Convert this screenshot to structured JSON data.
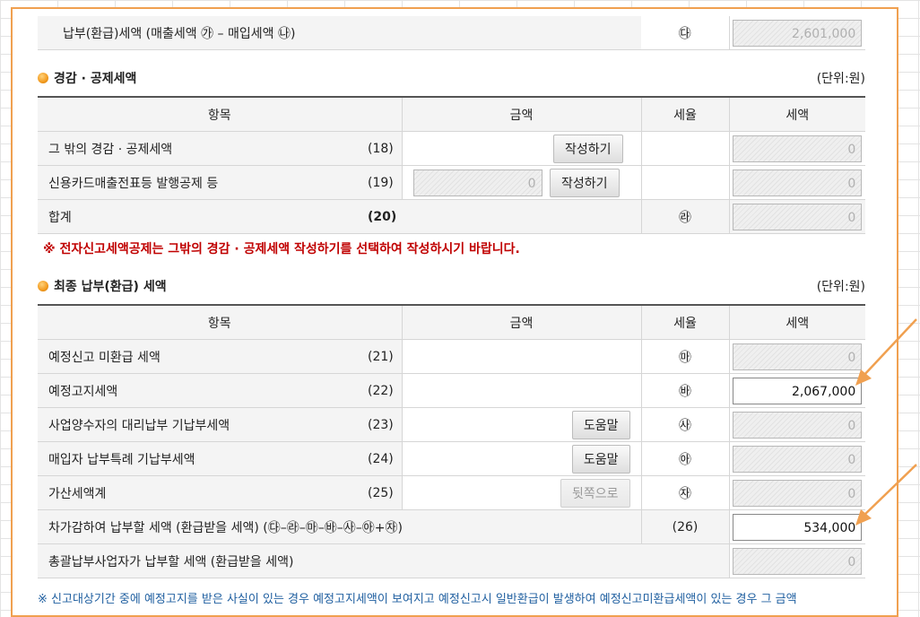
{
  "top_row": {
    "label": "납부(환급)세액 (매출세액 ㉮ – 매입세액 ㉯)",
    "mark": "㉰",
    "value": "2,601,000"
  },
  "section1": {
    "title": "경감 · 공제세액",
    "unit": "(단위:원)",
    "headers": [
      "항목",
      "금액",
      "세율",
      "세액"
    ],
    "rows": [
      {
        "label": "그 밖의 경감 · 공제세액",
        "num": "(18)",
        "button": "작성하기",
        "value": "0"
      },
      {
        "label": "신용카드매출전표등 발행공제 등",
        "num": "(19)",
        "amount": "0",
        "button": "작성하기",
        "value": "0"
      },
      {
        "label": "합계",
        "num": "(20)",
        "mark": "㉱",
        "value": "0"
      }
    ],
    "notice": "※ 전자신고세액공제는 그밖의 경감 · 공제세액 작성하기를 선택하여 작성하시기 바랍니다."
  },
  "section2": {
    "title": "최종 납부(환급) 세액",
    "unit": "(단위:원)",
    "headers": [
      "항목",
      "금액",
      "세율",
      "세액"
    ],
    "rows": [
      {
        "label": "예정신고 미환급 세액",
        "num": "(21)",
        "mark": "㉲",
        "value": "0"
      },
      {
        "label": "예정고지세액",
        "num": "(22)",
        "mark": "㉳",
        "value": "2,067,000"
      },
      {
        "label": "사업양수자의 대리납부 기납부세액",
        "num": "(23)",
        "button": "도움말",
        "mark": "㉴",
        "value": "0"
      },
      {
        "label": "매입자 납부특례 기납부세액",
        "num": "(24)",
        "button": "도움말",
        "mark": "㉵",
        "value": "0"
      },
      {
        "label": "가산세액계",
        "num": "(25)",
        "button": "뒷쪽으로",
        "mark": "㉶",
        "value": "0"
      },
      {
        "label": "차가감하여 납부할 세액 (환급받을 세액) (㉰–㉱–㉲–㉳–㉴–㉵+㉶)",
        "num": "(26)",
        "value": "534,000"
      },
      {
        "label": "총괄납부사업자가 납부할 세액 (환급받을 세액)",
        "value": "0"
      }
    ]
  },
  "footnote": "※ 신고대상기간 중에 예정고지를 받은 사실이 있는 경우 예정고지세액이 보여지고 예정신고시 일반환급이 발생하여 예정신고미환급세액이 있는 경우 그 금액",
  "colors": {
    "accent": "#f0a050",
    "notice": "#c00000",
    "footnote": "#1f5fa0"
  }
}
